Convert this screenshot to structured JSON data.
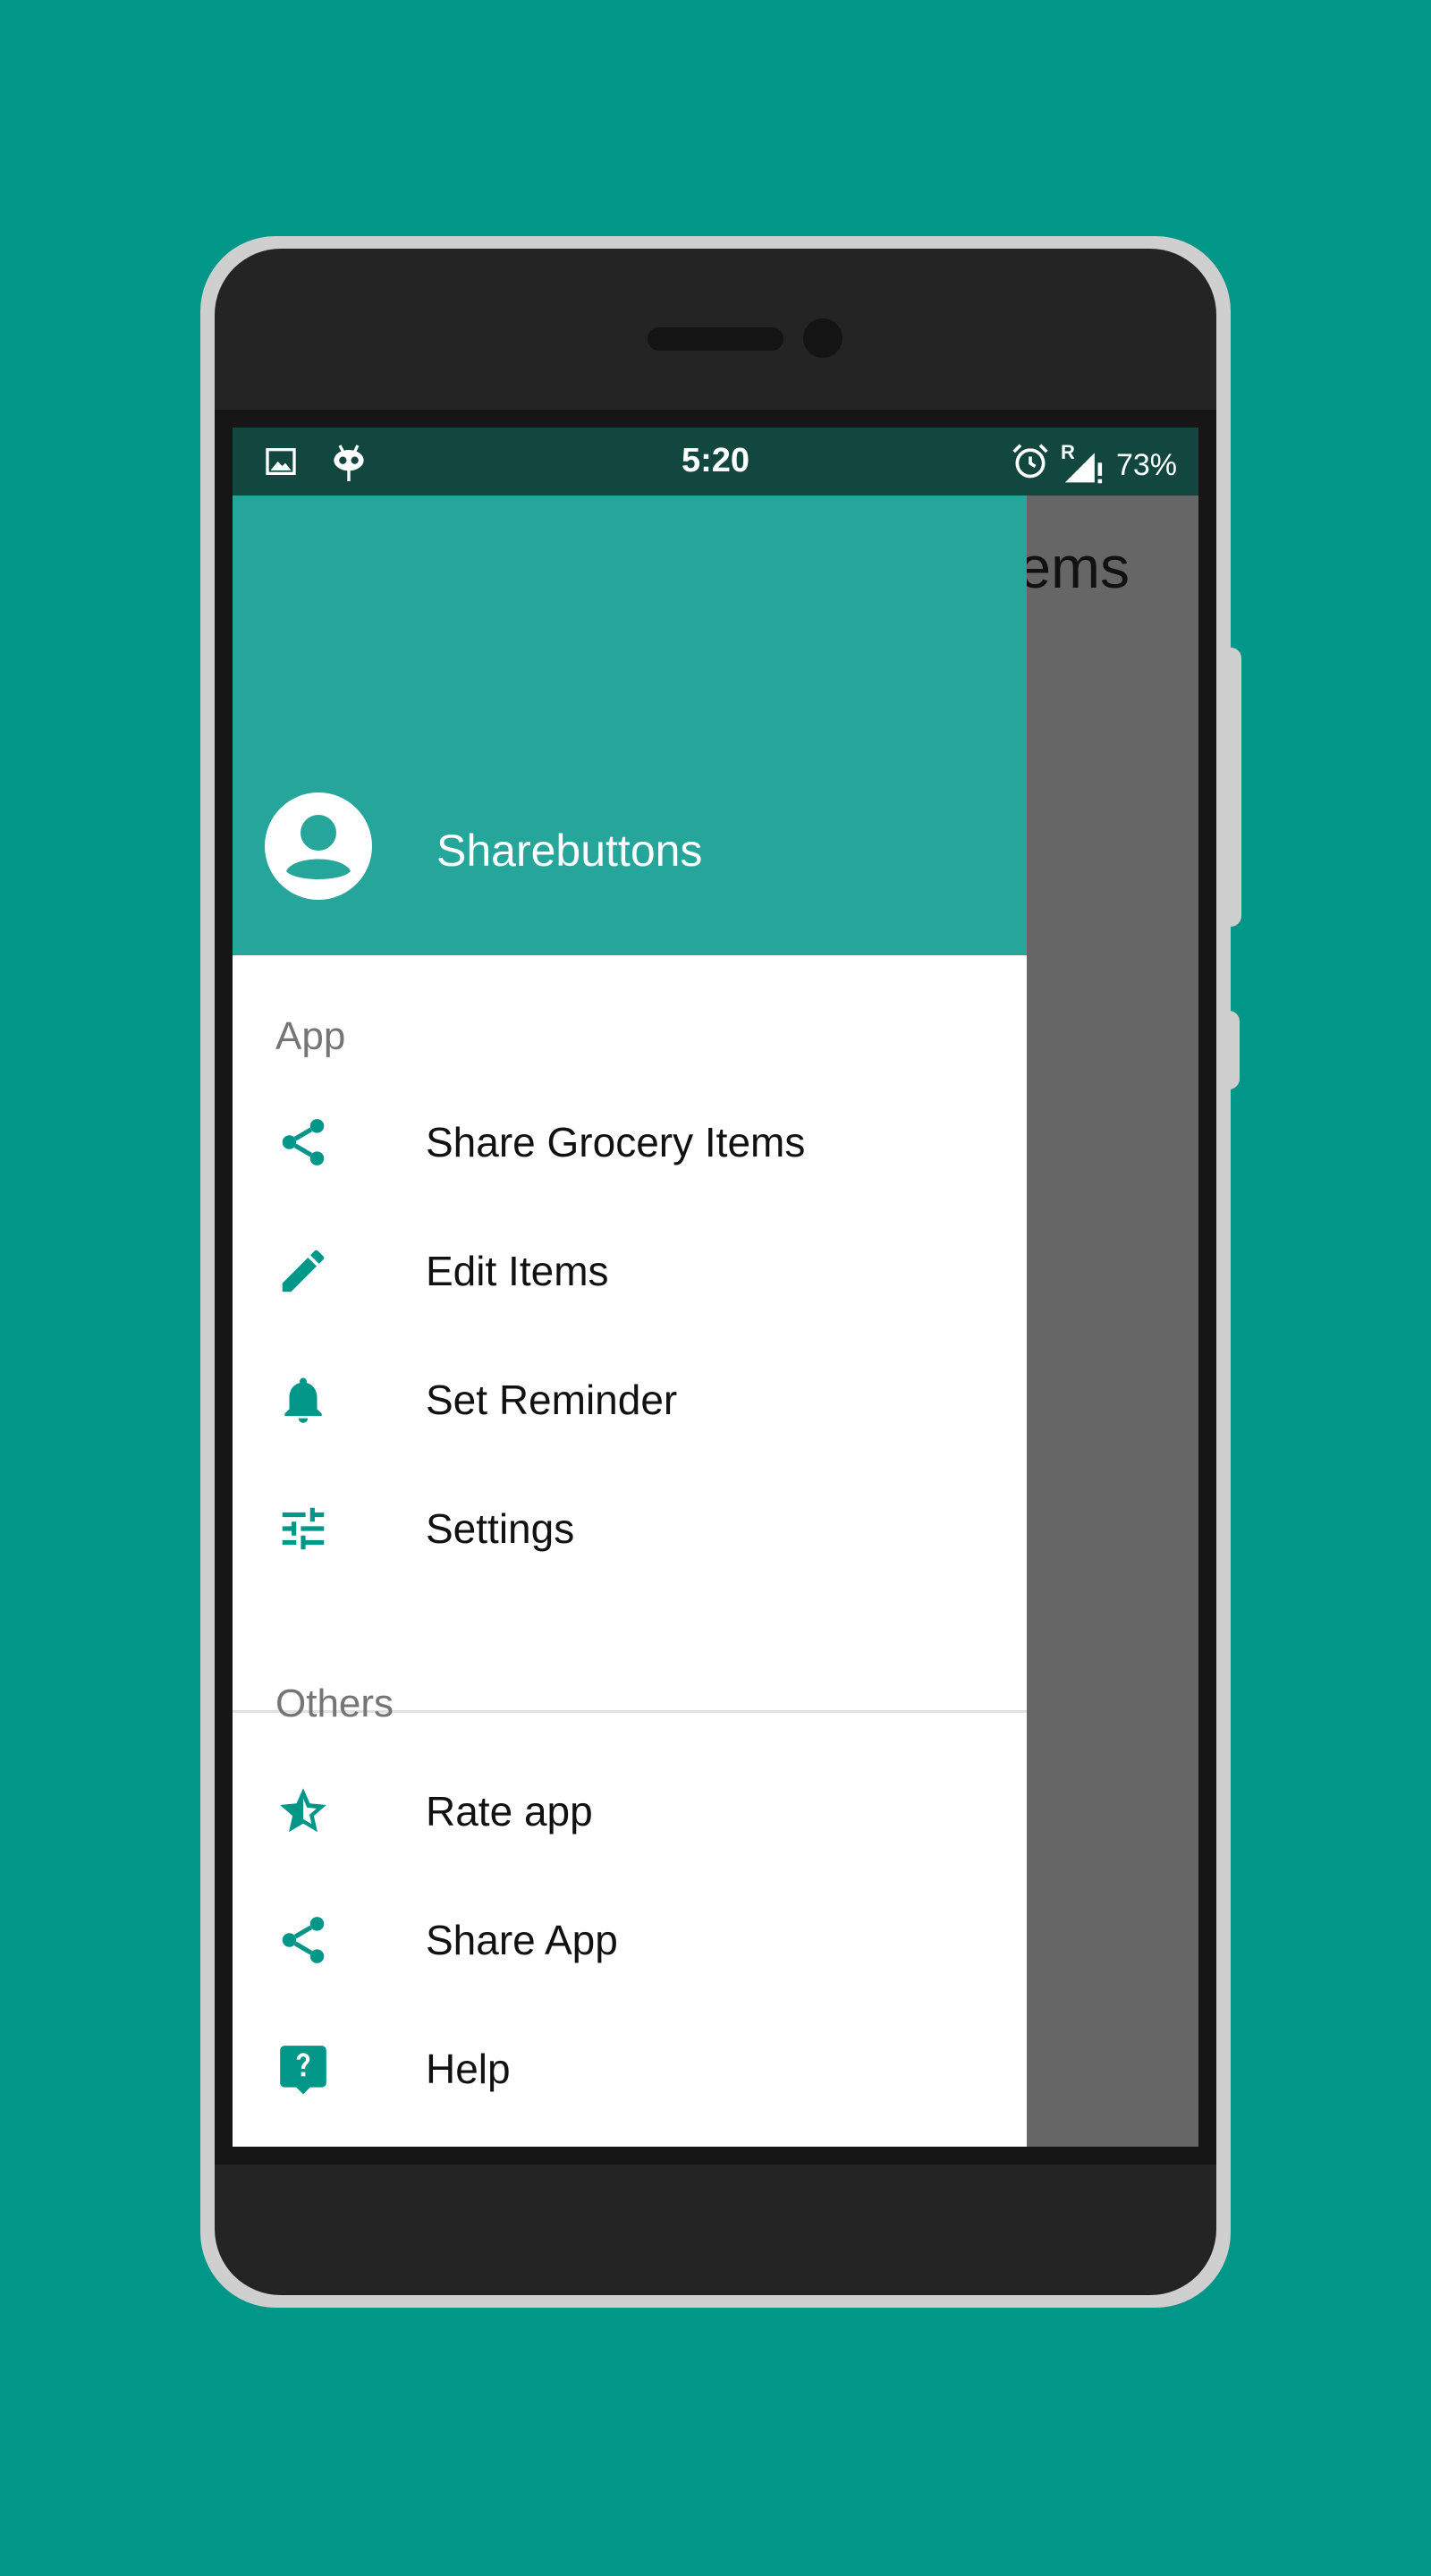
{
  "status_bar": {
    "time": "5:20",
    "battery": "73%",
    "roaming": "R",
    "left_icons": [
      "image-icon",
      "cyanogen-icon"
    ],
    "right_icons": [
      "alarm-icon",
      "signal-icon"
    ]
  },
  "background": {
    "title_partial": "tems"
  },
  "drawer": {
    "account_name": "Sharebuttons",
    "sections": [
      {
        "title": "App",
        "items": [
          {
            "label": "Share Grocery Items",
            "icon": "share-icon"
          },
          {
            "label": "Edit Items",
            "icon": "pencil-icon"
          },
          {
            "label": "Set Reminder",
            "icon": "bell-icon"
          },
          {
            "label": "Settings",
            "icon": "tune-icon"
          }
        ]
      },
      {
        "title": "Others",
        "items": [
          {
            "label": "Rate app",
            "icon": "star-icon"
          },
          {
            "label": "Share App",
            "icon": "share-icon"
          },
          {
            "label": "Help",
            "icon": "help-icon"
          }
        ]
      }
    ]
  },
  "colors": {
    "background": "#009688",
    "header": "#26a69a",
    "status_bar": "#124740",
    "icon": "#009688",
    "scrim": "#666666"
  }
}
